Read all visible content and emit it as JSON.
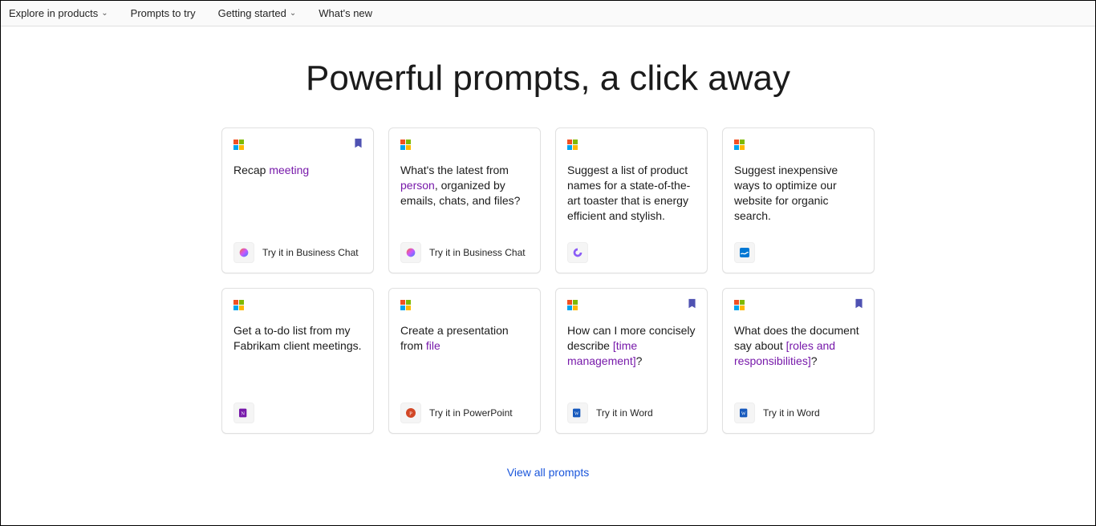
{
  "nav": {
    "explore": "Explore in products",
    "prompts": "Prompts to try",
    "getting": "Getting started",
    "whatsnew": "What's new"
  },
  "headline": "Powerful prompts, a click away",
  "viewall": "View all prompts",
  "try": {
    "bizchat": "Try it in Business Chat",
    "powerpoint": "Try it in PowerPoint",
    "word": "Try it in Word"
  },
  "cards": {
    "c0": {
      "pre": "Recap ",
      "hl": "meeting",
      "post": ""
    },
    "c1": {
      "pre": "What's the latest from ",
      "hl": "person",
      "post": ", organized by emails, chats, and files?"
    },
    "c2": {
      "text": "Suggest a list of product names for a state-of-the-art toaster that is energy efficient and stylish."
    },
    "c3": {
      "text": "Suggest inexpensive ways to optimize our website for organic search."
    },
    "c4": {
      "text": "Get a to-do list from my Fabrikam client meetings."
    },
    "c5": {
      "pre": "Create a presentation from ",
      "hl": "file",
      "post": ""
    },
    "c6": {
      "pre": "How can I more concisely describe ",
      "hl": "[time management]",
      "post": "?"
    },
    "c7": {
      "pre": "What does the document say about ",
      "hl": "[roles and responsibilities]",
      "post": "?"
    }
  }
}
